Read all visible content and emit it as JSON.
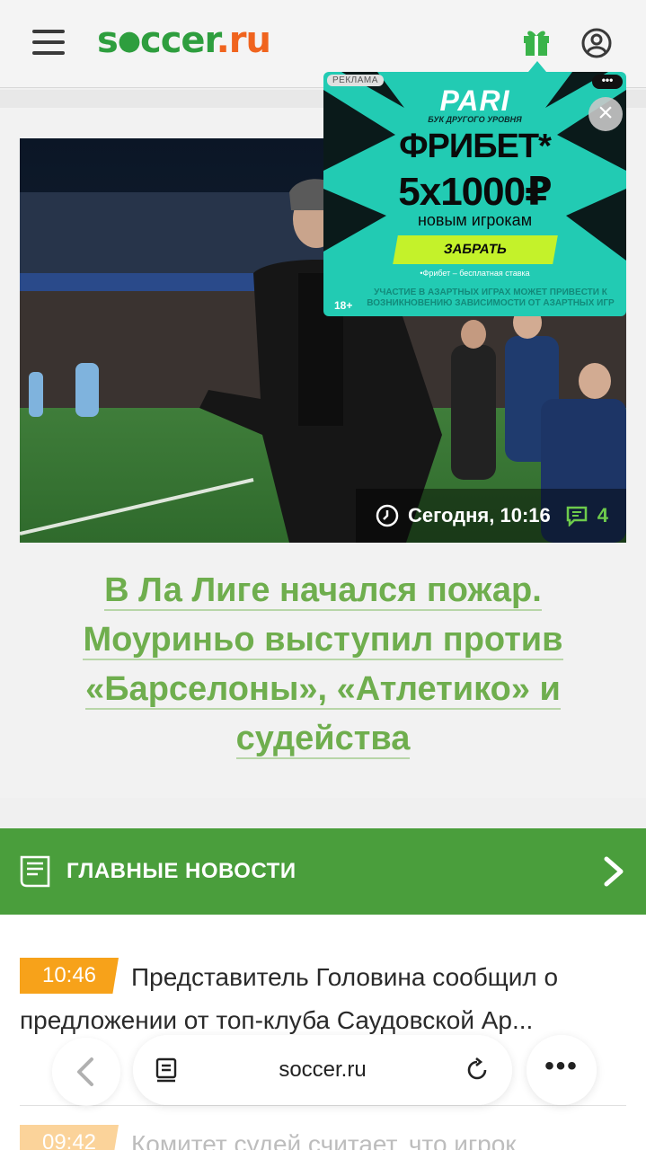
{
  "header": {
    "logo_part1": "s",
    "logo_ball": "●",
    "logo_part2": "ccer",
    "logo_dot": ".",
    "logo_part3": "ru"
  },
  "hero": {
    "time": "Сегодня, 10:16",
    "comments": "4",
    "headline": "В Ла Лиге начался пожар. Моуриньо выступил против «Барселоны», «Атлетико» и судейства"
  },
  "ad": {
    "label": "РЕКЛАМА",
    "menu": "•••",
    "close": "×",
    "brand": "PARI",
    "tagline": "БУК ДРУГОГО УРОВНЯ",
    "freebet": "ФРИБЕТ*",
    "amount": "5x1000₽",
    "subtitle": "новым игрокам",
    "button": "ЗАБРАТЬ",
    "note": "•Фрибет – бесплатная ставка",
    "age": "18+",
    "warning": "УЧАСТИЕ В АЗАРТНЫХ ИГРАХ МОЖЕТ ПРИВЕСТИ К ВОЗНИКНОВЕНИЮ ЗАВИСИМОСТИ ОТ АЗАРТНЫХ ИГР"
  },
  "main_news": {
    "title": "ГЛАВНЫЕ НОВОСТИ",
    "items": [
      {
        "time": "10:46",
        "text": "Представитель Головина сообщил о предложении от топ-клуба Саудовской Ар..."
      },
      {
        "time": "09:42",
        "text": "Комитет судей считает, что игрок"
      }
    ]
  },
  "browser": {
    "url": "soccer.ru"
  },
  "colors": {
    "brand_green": "#4a9e3c",
    "headline_green": "#6fae4e",
    "accent_orange": "#f7a21a",
    "ad_teal": "#22cbb3"
  }
}
